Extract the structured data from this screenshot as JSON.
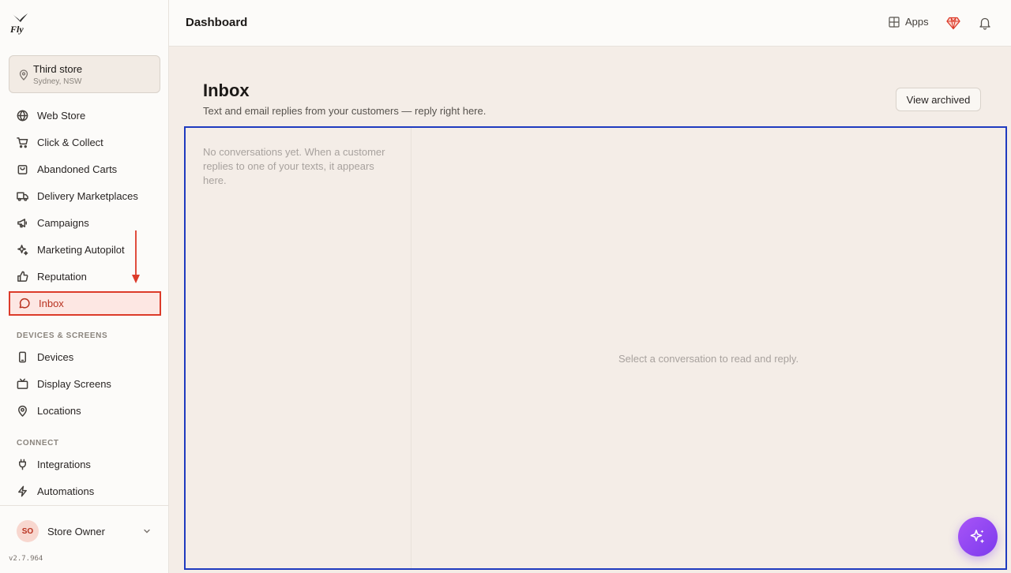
{
  "brand": {
    "logo_text": "Fly"
  },
  "store": {
    "name": "Third store",
    "location": "Sydney, NSW",
    "icon": "map-pin-icon"
  },
  "sidebar": {
    "items": [
      {
        "label": "Web Store",
        "icon": "globe-icon"
      },
      {
        "label": "Click & Collect",
        "icon": "cart-icon"
      },
      {
        "label": "Abandoned Carts",
        "icon": "bag-icon"
      },
      {
        "label": "Delivery Marketplaces",
        "icon": "truck-icon"
      },
      {
        "label": "Campaigns",
        "icon": "megaphone-icon"
      },
      {
        "label": "Marketing Autopilot",
        "icon": "sparkles-icon"
      },
      {
        "label": "Reputation",
        "icon": "thumbs-up-icon"
      },
      {
        "label": "Inbox",
        "icon": "message-circle-icon",
        "active": true
      }
    ],
    "devices_section": {
      "title": "DEVICES & SCREENS",
      "items": [
        {
          "label": "Devices",
          "icon": "phone-icon"
        },
        {
          "label": "Display Screens",
          "icon": "tv-icon"
        },
        {
          "label": "Locations",
          "icon": "map-pin-icon"
        }
      ]
    },
    "connect_section": {
      "title": "CONNECT",
      "items": [
        {
          "label": "Integrations",
          "icon": "plug-icon"
        },
        {
          "label": "Automations",
          "icon": "zap-icon"
        }
      ]
    },
    "user": {
      "initials": "SO",
      "name": "Store Owner"
    },
    "version": "v2.7.964"
  },
  "topbar": {
    "title": "Dashboard",
    "apps_label": "Apps"
  },
  "main": {
    "title": "Inbox",
    "subtitle": "Text and email replies from your customers — reply right here.",
    "view_archived_label": "View archived",
    "empty_list_text": "No conversations yet. When a customer replies to one of your texts, it appears here.",
    "empty_detail_text": "Select a conversation to read and reply."
  },
  "colors": {
    "accent": "#dc3b2a",
    "active_bg": "#fde7e3",
    "panel_outline": "#1f3bbf",
    "fab": "#8b5cf6"
  }
}
